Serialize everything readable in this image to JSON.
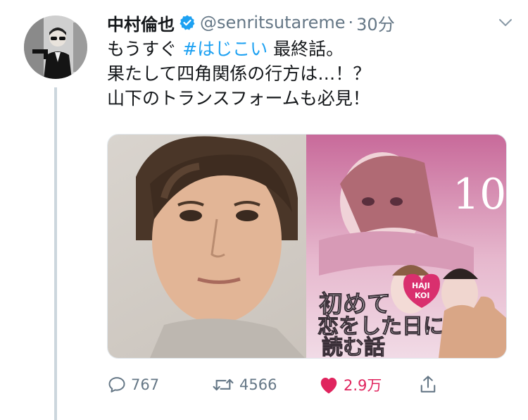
{
  "tweet": {
    "display_name": "中村倫也",
    "handle": "@senritsutareme",
    "separator": "·",
    "time": "30分",
    "verified_icon": "verified-badge-icon",
    "text": {
      "line1_prefix": "もうすぐ ",
      "line1_hashtag": "#はじこい",
      "line1_suffix": " 最終話。",
      "line2": "果たして四角関係の行方は…！？",
      "line3": "山下のトランスフォームも必見！"
    },
    "media": {
      "book_volume": "10",
      "book_title_lines": [
        "初めて",
        "恋をした日に",
        "読む話"
      ],
      "badge_lines": [
        "HAJI",
        "KOI"
      ]
    },
    "actions": {
      "reply_count": "767",
      "retweet_count": "4566",
      "like_count": "2.9万",
      "reply_icon": "reply-icon",
      "retweet_icon": "retweet-icon",
      "like_icon": "heart-icon",
      "share_icon": "share-icon"
    }
  },
  "colors": {
    "accent": "#1da1f2",
    "like": "#e0245e",
    "muted": "#657786",
    "thread_line": "#ccd6dd"
  }
}
